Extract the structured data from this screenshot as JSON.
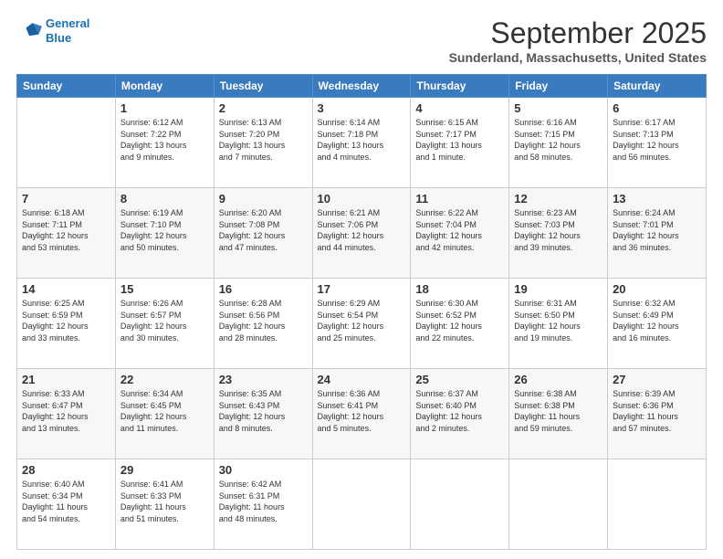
{
  "header": {
    "logo_line1": "General",
    "logo_line2": "Blue",
    "month_title": "September 2025",
    "location": "Sunderland, Massachusetts, United States"
  },
  "days_of_week": [
    "Sunday",
    "Monday",
    "Tuesday",
    "Wednesday",
    "Thursday",
    "Friday",
    "Saturday"
  ],
  "weeks": [
    [
      {
        "day": "",
        "content": ""
      },
      {
        "day": "1",
        "content": "Sunrise: 6:12 AM\nSunset: 7:22 PM\nDaylight: 13 hours\nand 9 minutes."
      },
      {
        "day": "2",
        "content": "Sunrise: 6:13 AM\nSunset: 7:20 PM\nDaylight: 13 hours\nand 7 minutes."
      },
      {
        "day": "3",
        "content": "Sunrise: 6:14 AM\nSunset: 7:18 PM\nDaylight: 13 hours\nand 4 minutes."
      },
      {
        "day": "4",
        "content": "Sunrise: 6:15 AM\nSunset: 7:17 PM\nDaylight: 13 hours\nand 1 minute."
      },
      {
        "day": "5",
        "content": "Sunrise: 6:16 AM\nSunset: 7:15 PM\nDaylight: 12 hours\nand 58 minutes."
      },
      {
        "day": "6",
        "content": "Sunrise: 6:17 AM\nSunset: 7:13 PM\nDaylight: 12 hours\nand 56 minutes."
      }
    ],
    [
      {
        "day": "7",
        "content": "Sunrise: 6:18 AM\nSunset: 7:11 PM\nDaylight: 12 hours\nand 53 minutes."
      },
      {
        "day": "8",
        "content": "Sunrise: 6:19 AM\nSunset: 7:10 PM\nDaylight: 12 hours\nand 50 minutes."
      },
      {
        "day": "9",
        "content": "Sunrise: 6:20 AM\nSunset: 7:08 PM\nDaylight: 12 hours\nand 47 minutes."
      },
      {
        "day": "10",
        "content": "Sunrise: 6:21 AM\nSunset: 7:06 PM\nDaylight: 12 hours\nand 44 minutes."
      },
      {
        "day": "11",
        "content": "Sunrise: 6:22 AM\nSunset: 7:04 PM\nDaylight: 12 hours\nand 42 minutes."
      },
      {
        "day": "12",
        "content": "Sunrise: 6:23 AM\nSunset: 7:03 PM\nDaylight: 12 hours\nand 39 minutes."
      },
      {
        "day": "13",
        "content": "Sunrise: 6:24 AM\nSunset: 7:01 PM\nDaylight: 12 hours\nand 36 minutes."
      }
    ],
    [
      {
        "day": "14",
        "content": "Sunrise: 6:25 AM\nSunset: 6:59 PM\nDaylight: 12 hours\nand 33 minutes."
      },
      {
        "day": "15",
        "content": "Sunrise: 6:26 AM\nSunset: 6:57 PM\nDaylight: 12 hours\nand 30 minutes."
      },
      {
        "day": "16",
        "content": "Sunrise: 6:28 AM\nSunset: 6:56 PM\nDaylight: 12 hours\nand 28 minutes."
      },
      {
        "day": "17",
        "content": "Sunrise: 6:29 AM\nSunset: 6:54 PM\nDaylight: 12 hours\nand 25 minutes."
      },
      {
        "day": "18",
        "content": "Sunrise: 6:30 AM\nSunset: 6:52 PM\nDaylight: 12 hours\nand 22 minutes."
      },
      {
        "day": "19",
        "content": "Sunrise: 6:31 AM\nSunset: 6:50 PM\nDaylight: 12 hours\nand 19 minutes."
      },
      {
        "day": "20",
        "content": "Sunrise: 6:32 AM\nSunset: 6:49 PM\nDaylight: 12 hours\nand 16 minutes."
      }
    ],
    [
      {
        "day": "21",
        "content": "Sunrise: 6:33 AM\nSunset: 6:47 PM\nDaylight: 12 hours\nand 13 minutes."
      },
      {
        "day": "22",
        "content": "Sunrise: 6:34 AM\nSunset: 6:45 PM\nDaylight: 12 hours\nand 11 minutes."
      },
      {
        "day": "23",
        "content": "Sunrise: 6:35 AM\nSunset: 6:43 PM\nDaylight: 12 hours\nand 8 minutes."
      },
      {
        "day": "24",
        "content": "Sunrise: 6:36 AM\nSunset: 6:41 PM\nDaylight: 12 hours\nand 5 minutes."
      },
      {
        "day": "25",
        "content": "Sunrise: 6:37 AM\nSunset: 6:40 PM\nDaylight: 12 hours\nand 2 minutes."
      },
      {
        "day": "26",
        "content": "Sunrise: 6:38 AM\nSunset: 6:38 PM\nDaylight: 11 hours\nand 59 minutes."
      },
      {
        "day": "27",
        "content": "Sunrise: 6:39 AM\nSunset: 6:36 PM\nDaylight: 11 hours\nand 57 minutes."
      }
    ],
    [
      {
        "day": "28",
        "content": "Sunrise: 6:40 AM\nSunset: 6:34 PM\nDaylight: 11 hours\nand 54 minutes."
      },
      {
        "day": "29",
        "content": "Sunrise: 6:41 AM\nSunset: 6:33 PM\nDaylight: 11 hours\nand 51 minutes."
      },
      {
        "day": "30",
        "content": "Sunrise: 6:42 AM\nSunset: 6:31 PM\nDaylight: 11 hours\nand 48 minutes."
      },
      {
        "day": "",
        "content": ""
      },
      {
        "day": "",
        "content": ""
      },
      {
        "day": "",
        "content": ""
      },
      {
        "day": "",
        "content": ""
      }
    ]
  ]
}
